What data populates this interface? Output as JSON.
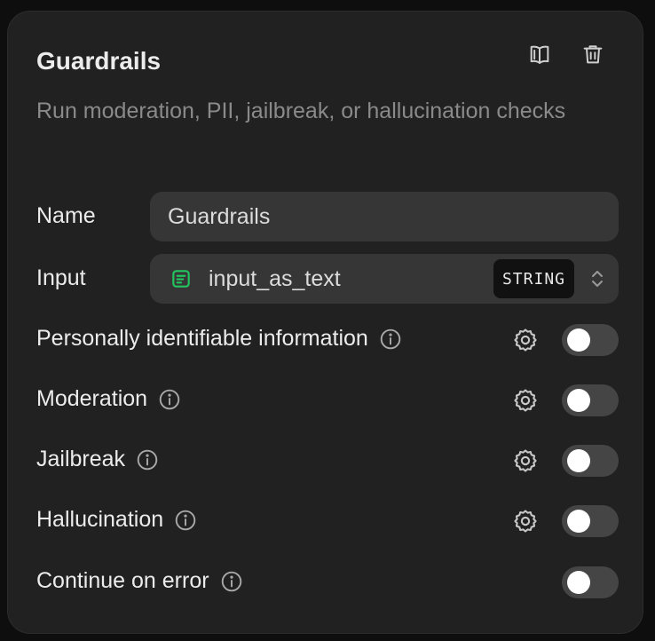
{
  "panel": {
    "title": "Guardrails",
    "subtitle": "Run moderation, PII, jailbreak, or hallucination checks",
    "header_icons": [
      "book-icon",
      "trash-icon"
    ]
  },
  "name_field": {
    "label": "Name",
    "value": "Guardrails"
  },
  "input_field": {
    "label": "Input",
    "variable": "input_as_text",
    "type": "STRING",
    "variable_icon_color": "#22c55e"
  },
  "checks": [
    {
      "label": "Personally identifiable information",
      "has_settings": true,
      "enabled": false
    },
    {
      "label": "Moderation",
      "has_settings": true,
      "enabled": false
    },
    {
      "label": "Jailbreak",
      "has_settings": true,
      "enabled": false
    },
    {
      "label": "Hallucination",
      "has_settings": true,
      "enabled": false
    }
  ],
  "continue_on_error": {
    "label": "Continue on error",
    "enabled": false
  },
  "colors": {
    "panel_bg": "#212121",
    "field_bg": "#363636",
    "toggle_off": "#454545",
    "text": "#ececec",
    "muted_text": "#8a8a8a"
  }
}
